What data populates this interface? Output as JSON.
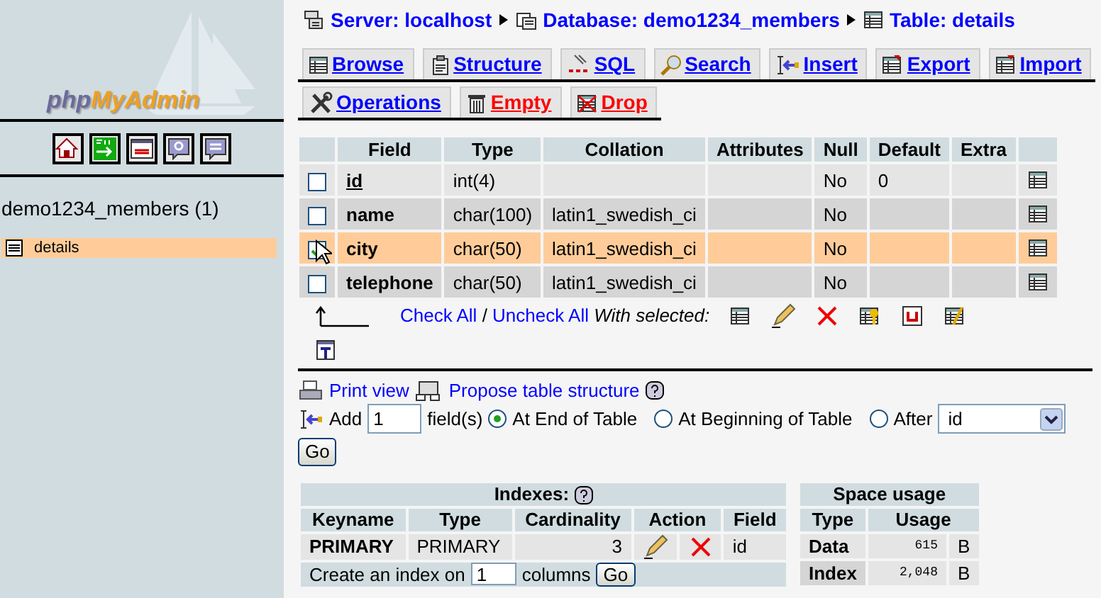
{
  "sidebar": {
    "logo": "phpMyAdmin",
    "database": "demo1234_members (1)",
    "tables": [
      {
        "label": "details",
        "selected": true
      }
    ]
  },
  "breadcrumb": [
    {
      "label": "Server: localhost"
    },
    {
      "label": "Database: demo1234_members"
    },
    {
      "label": "Table: details"
    }
  ],
  "tabs": [
    [
      {
        "label": "Browse",
        "kind": "normal"
      },
      {
        "label": "Structure",
        "kind": "normal"
      },
      {
        "label": "SQL",
        "kind": "normal"
      },
      {
        "label": "Search",
        "kind": "normal"
      },
      {
        "label": "Insert",
        "kind": "normal"
      },
      {
        "label": "Export",
        "kind": "normal"
      },
      {
        "label": "Import",
        "kind": "normal"
      }
    ],
    [
      {
        "label": "Operations",
        "kind": "normal"
      },
      {
        "label": "Empty",
        "kind": "danger"
      },
      {
        "label": "Drop",
        "kind": "danger"
      }
    ]
  ],
  "structure": {
    "columns": [
      "Field",
      "Type",
      "Collation",
      "Attributes",
      "Null",
      "Default",
      "Extra"
    ],
    "rows": [
      {
        "field": "id",
        "primary": true,
        "type": "int(4)",
        "null": "No",
        "default": "0",
        "checked": false,
        "highlighted": false
      },
      {
        "field": "name",
        "primary": false,
        "type": "char(100)",
        "collation": "latin1_swedish_ci",
        "null": "No",
        "checked": false,
        "highlighted": false
      },
      {
        "field": "city",
        "primary": false,
        "type": "char(50)",
        "collation": "latin1_swedish_ci",
        "null": "No",
        "checked": true,
        "highlighted": true
      },
      {
        "field": "telephone",
        "primary": false,
        "type": "char(50)",
        "collation": "latin1_swedish_ci",
        "null": "No",
        "checked": false,
        "highlighted": false
      }
    ],
    "check_all": "Check All",
    "separator": "/",
    "uncheck_all": "Uncheck All",
    "with_selected": "With selected:"
  },
  "links": [
    {
      "label": "Print view"
    },
    {
      "label": "Propose table structure"
    }
  ],
  "add_fields": {
    "label": "Add",
    "count": "1",
    "suffix": "field(s)",
    "positions": [
      {
        "label": "At End of Table",
        "selected": true
      },
      {
        "label": "At Beginning of Table",
        "selected": false
      },
      {
        "label": "After",
        "selected": false
      }
    ],
    "after_field": "id",
    "button": "Go"
  },
  "indexes": {
    "title": "Indexes:",
    "columns": [
      "Keyname",
      "Type",
      "Cardinality",
      "Action",
      "Field"
    ],
    "rows": [
      {
        "keyname": "PRIMARY",
        "type": "PRIMARY",
        "cardinality": "3",
        "field": "id"
      }
    ],
    "create_label": "Create an index on",
    "create_count": "1",
    "create_suffix": "columns",
    "create_button": "Go"
  },
  "space_usage": {
    "title": "Space usage",
    "columns": [
      "Type",
      "Usage"
    ],
    "rows": [
      {
        "type": "Data",
        "usage": "615",
        "unit": "B"
      },
      {
        "type": "Index",
        "usage": "2,048",
        "unit": "B"
      }
    ]
  }
}
